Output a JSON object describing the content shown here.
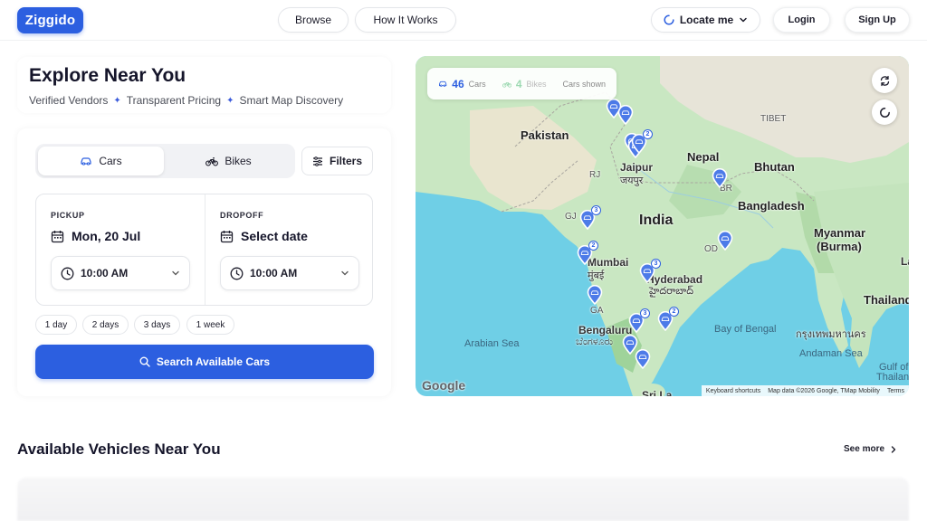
{
  "header": {
    "logo": "Ziggido",
    "nav": [
      "Browse",
      "How It Works"
    ],
    "locate_label": "Locate me",
    "login_label": "Login",
    "signup_label": "Sign Up"
  },
  "hero": {
    "title": "Explore Near You",
    "features": [
      "Verified Vendors",
      "Transparent Pricing",
      "Smart Map Discovery"
    ]
  },
  "search": {
    "tabs": [
      {
        "label": "Cars",
        "selected": true
      },
      {
        "label": "Bikes",
        "selected": false
      }
    ],
    "filters_label": "Filters",
    "pickup": {
      "label": "PICKUP",
      "date": "Mon, 20 Jul",
      "time": "10:00 AM"
    },
    "dropoff": {
      "label": "DROPOFF",
      "date": "Select date",
      "time": "10:00 AM"
    },
    "durations": [
      "1 day",
      "2 days",
      "3 days",
      "1 week"
    ],
    "submit_label": "Search Available Cars"
  },
  "map": {
    "stats": {
      "cars_count": "46",
      "cars_label": "Cars",
      "bikes_count": "4",
      "bikes_label": "Bikes",
      "shown_label": "Cars shown"
    },
    "labels": {
      "pakistan": "Pakistan",
      "nepal": "Nepal",
      "bhutan": "Bhutan",
      "tibet": "TIBET",
      "india": "India",
      "bangladesh": "Bangladesh",
      "myanmar1": "Myanmar",
      "myanmar2": "(Burma)",
      "thailand": "Thailand",
      "jaipur": "Jaipur",
      "jaipur_hi": "जयपुर",
      "mumbai": "Mumbai",
      "mumbai_hi": "मुंबई",
      "hyderabad": "Hyderabad",
      "hyderabad_te": "హైదరాబాద్",
      "bengaluru": "Bengaluru",
      "bengaluru_kn": "ಬೆಂಗಳೂರು",
      "bangkok": "กรุงเทพมหานคร",
      "arabian_sea": "Arabian Sea",
      "bay_of_bengal": "Bay of Bengal",
      "andaman_sea": "Andaman Sea",
      "gulf_of": "Gulf of",
      "thailand_gulf": "Thailand",
      "sri_lanka": "Sri La",
      "lao": "Lao",
      "rj": "RJ",
      "gj": "GJ",
      "br": "BR",
      "od": "OD",
      "ga": "GA"
    },
    "pin_badges": [
      "2",
      "3",
      "2",
      "3",
      "3",
      "2"
    ],
    "google": "Google",
    "attribution": [
      "Keyboard shortcuts",
      "Map data ©2026 Google, TMap Mobility",
      "Terms"
    ]
  },
  "vehicles": {
    "title": "Available Vehicles Near You",
    "see_more": "See more"
  }
}
